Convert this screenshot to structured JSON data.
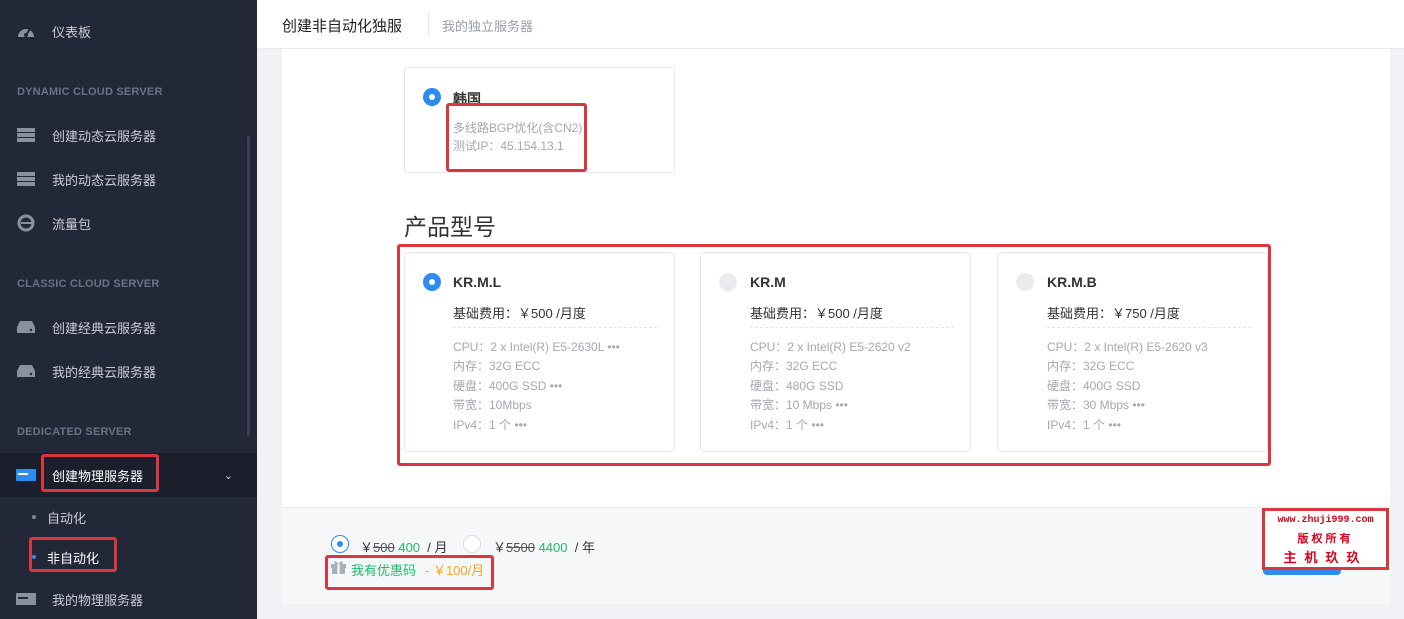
{
  "sidebar": {
    "dashboard": "仪表板",
    "sections": {
      "dynamic": "DYNAMIC CLOUD SERVER",
      "classic": "CLASSIC CLOUD SERVER",
      "dedicated": "DEDICATED SERVER"
    },
    "dynamic_items": [
      "创建动态云服务器",
      "我的动态云服务器",
      "流量包"
    ],
    "classic_items": [
      "创建经典云服务器",
      "我的经典云服务器"
    ],
    "dedicated_create": "创建物理服务器",
    "dedicated_sub": [
      "自动化",
      "非自动化"
    ],
    "dedicated_mine": "我的物理服务器"
  },
  "header": {
    "title": "创建非自动化独服",
    "breadcrumb": "我的独立服务器"
  },
  "region": {
    "name": "韩国",
    "line1": "多线路BGP优化(含CN2)",
    "line2": "测试IP：45.154.13.1"
  },
  "products_title": "产品型号",
  "products": [
    {
      "name": "KR.M.L",
      "fee": "基础费用：￥500 /月度",
      "selected": true,
      "specs": [
        "CPU：2 x Intel(R) E5-2630L •••",
        "内存：32G ECC",
        "硬盘：400G SSD •••",
        "带宽：10Mbps",
        "IPv4：1 个 •••"
      ]
    },
    {
      "name": "KR.M",
      "fee": "基础费用：￥500 /月度",
      "selected": false,
      "specs": [
        "CPU：2 x Intel(R) E5-2620 v2",
        "内存：32G ECC",
        "硬盘：480G SSD",
        "带宽：10 Mbps •••",
        "IPv4：1 个 •••"
      ]
    },
    {
      "name": "KR.M.B",
      "fee": "基础费用：￥750 /月度",
      "selected": false,
      "specs": [
        "CPU：2 x Intel(R) E5-2620 v3",
        "内存：32G ECC",
        "硬盘：400G SSD",
        "带宽：30 Mbps •••",
        "IPv4：1 个 •••"
      ]
    }
  ],
  "pricing": {
    "monthly": {
      "currency": "￥",
      "old": "500",
      "new": "400",
      "unit": "/ 月"
    },
    "yearly": {
      "currency": "￥",
      "old": "5500",
      "new": "4400",
      "unit": "/ 年"
    },
    "coupon_label": "我有优惠码",
    "coupon_amount": "- ￥100/月"
  },
  "watermark": {
    "url": "www.zhuji999.com",
    "line2": "版权所有",
    "line3": "主机玖玖"
  },
  "colors": {
    "accent": "#2d8cf0",
    "sidebar_bg": "#232838",
    "highlight_red": "#d9363e",
    "price_green": "#19be6b",
    "coupon_orange": "#f5a623"
  }
}
